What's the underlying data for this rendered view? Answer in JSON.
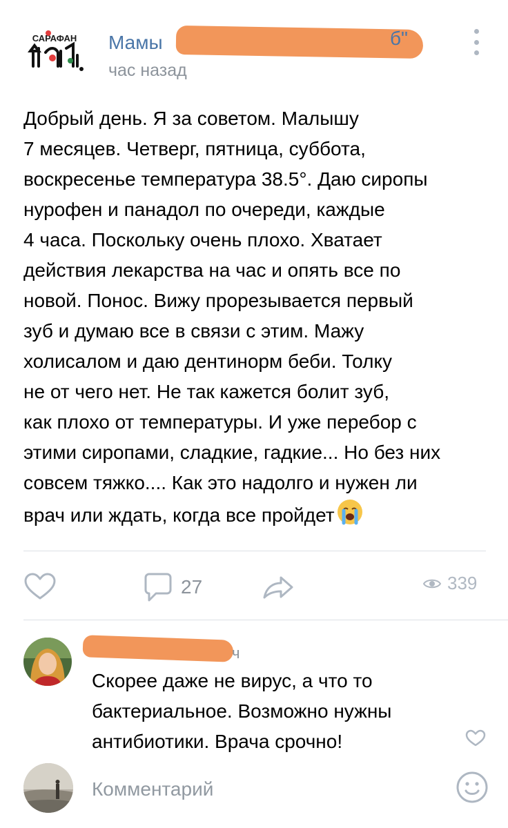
{
  "post": {
    "group_logo_text": "САРАФАН",
    "group_name_visible": "Мамы",
    "group_name_tail": "б\"",
    "time": "час назад",
    "text": "Добрый день. Я за советом. Малышу\n7 месяцев. Четверг, пятница, суббота,\nвоскресенье температура 38.5°. Даю сиропы\nнурофен и панадол по очереди, каждые\n4 часа. Поскольку очень плохо. Хватает\nдействия лекарства на час и опять все по\nновой. Понос. Вижу прорезывается первый\nзуб и думаю все в связи с этим. Мажу\nхолисалом и даю дентинорм беби. Толку\nне от чего нет. Не так кажется болит зуб,\nкак плохо от температуры. И уже перебор с\nэтими сиропами, сладкие, гадкие... Но без них\nсовсем тяжко.... Как это надолго и нужен ли\nврач или ждать, когда все пройдет",
    "emoji": "crying-face"
  },
  "actions": {
    "comments_count": "27",
    "views_count": "339"
  },
  "comment": {
    "author_tail": "ч",
    "text": "Скорее даже не вирус, а что то\nбактериальное. Возможно нужны\nантибиотики. Врача срочно!"
  },
  "compose": {
    "placeholder": "Комментарий"
  },
  "colors": {
    "link": "#4a76a8",
    "secondary": "#8c939b",
    "icon": "#aeb7c2",
    "redaction": "#f2965a"
  }
}
